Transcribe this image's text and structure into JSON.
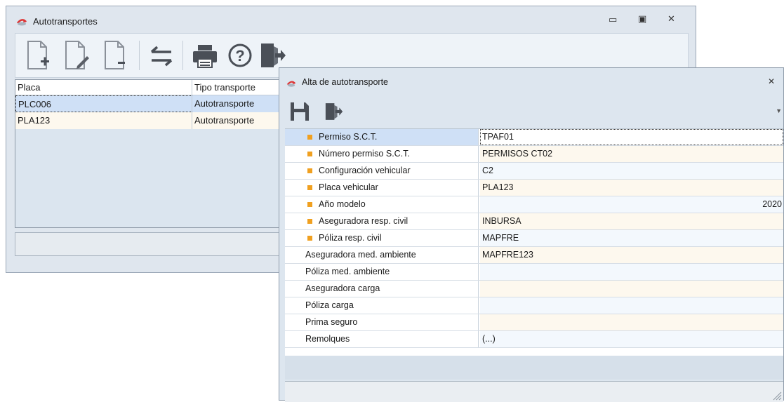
{
  "back_window": {
    "title": "Autotransportes",
    "toolbar": {
      "icons": [
        "new-document-icon",
        "edit-document-icon",
        "delete-document-icon",
        "transfer-arrows-icon",
        "print-icon",
        "help-icon",
        "exit-icon"
      ]
    },
    "grid": {
      "columns": [
        "Placa",
        "Tipo transporte"
      ],
      "rows": [
        {
          "placa": "PLC006",
          "tipo": "Autotransporte"
        },
        {
          "placa": "PLA123",
          "tipo": "Autotransporte"
        }
      ]
    }
  },
  "dialog": {
    "title": "Alta de autotransporte",
    "toolbar": {
      "icons": [
        "save-icon",
        "exit-icon"
      ]
    },
    "properties": [
      {
        "label": "Permiso S.C.T.",
        "value": "TPAF01",
        "required": true
      },
      {
        "label": "Número permiso S.C.T.",
        "value": "PERMISOS CT02",
        "required": true
      },
      {
        "label": "Configuración vehicular",
        "value": "C2",
        "required": true
      },
      {
        "label": "Placa vehicular",
        "value": "PLA123",
        "required": true
      },
      {
        "label": "Año modelo",
        "value": "2020",
        "required": true,
        "align": "right"
      },
      {
        "label": "Aseguradora resp. civil",
        "value": "INBURSA",
        "required": true
      },
      {
        "label": "Póliza resp. civil",
        "value": "MAPFRE",
        "required": true
      },
      {
        "label": "Aseguradora med. ambiente",
        "value": "MAPFRE123",
        "required": false
      },
      {
        "label": "Póliza med. ambiente",
        "value": "",
        "required": false
      },
      {
        "label": "Aseguradora carga",
        "value": "",
        "required": false
      },
      {
        "label": "Póliza carga",
        "value": "",
        "required": false
      },
      {
        "label": "Prima seguro",
        "value": "",
        "required": false
      },
      {
        "label": "Remolques",
        "value": "(...)",
        "required": false
      }
    ]
  },
  "colors": {
    "required_bullet": "#f0a020",
    "selected_row": "#cfe0f6",
    "alt_row": "#fdf8ee"
  }
}
